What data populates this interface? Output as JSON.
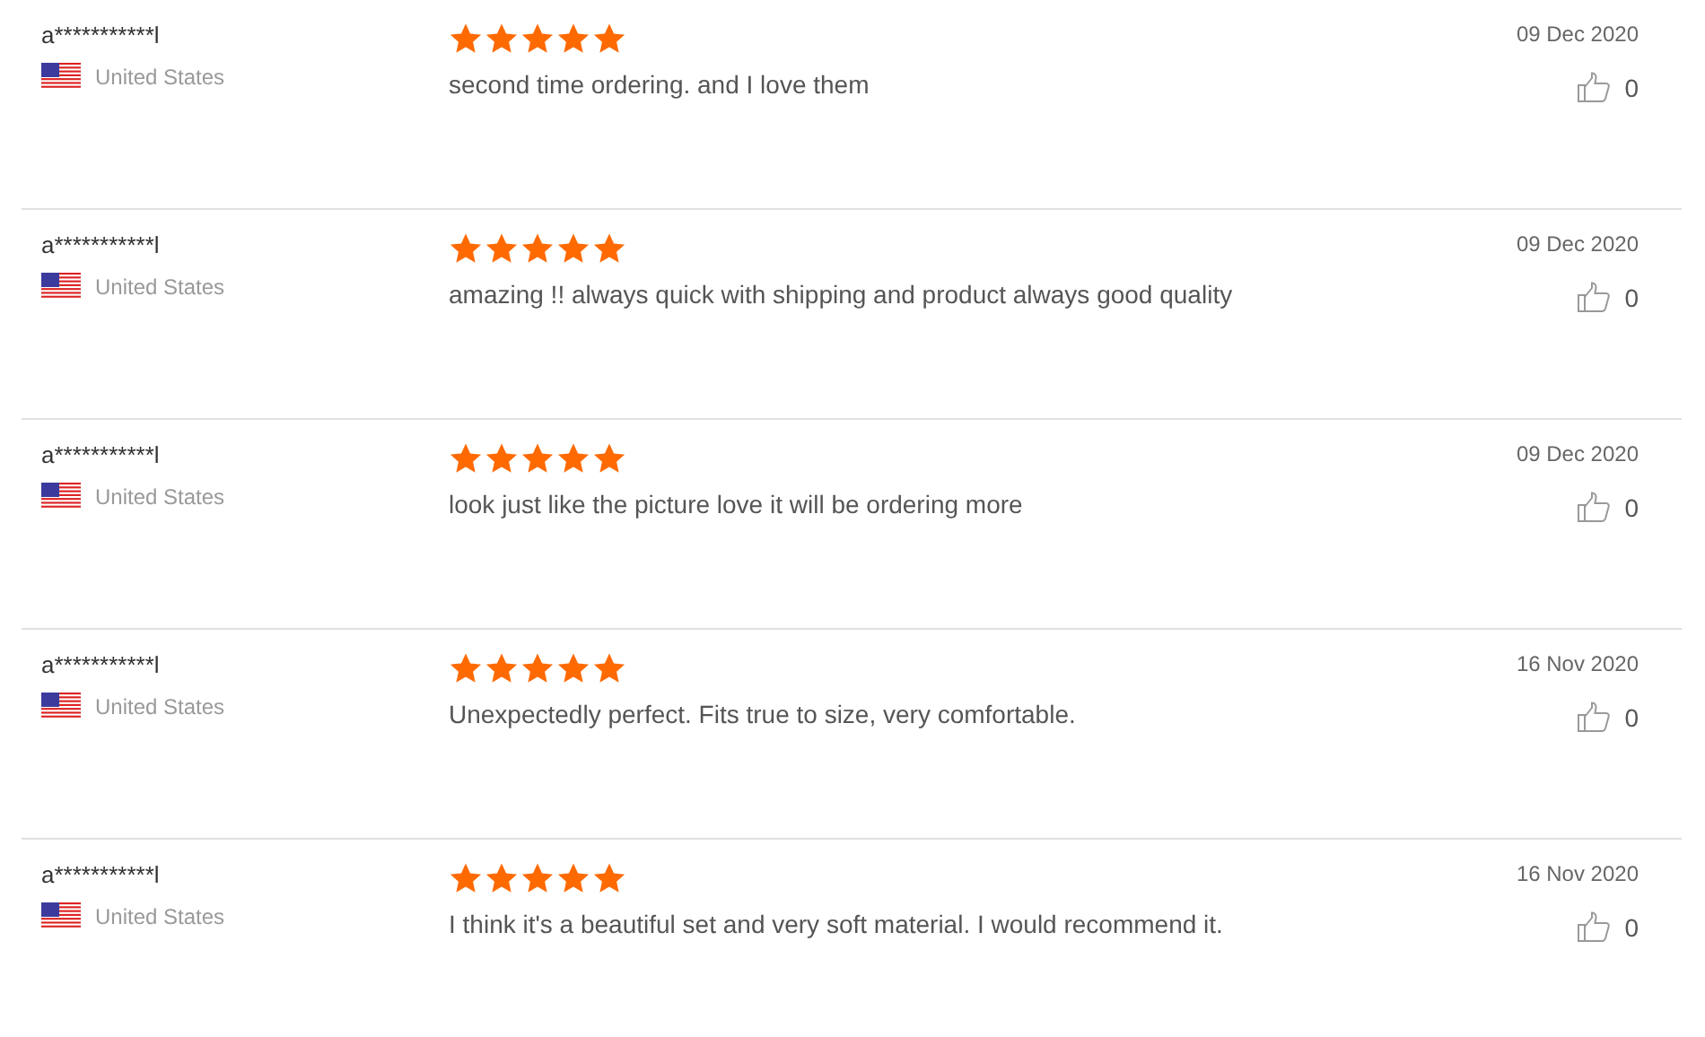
{
  "reviews": [
    {
      "name": "a***********l",
      "country": "United States",
      "stars": 5,
      "text": "second time ordering. and I love them",
      "date": "09 Dec 2020",
      "likes": "0"
    },
    {
      "name": "a***********l",
      "country": "United States",
      "stars": 5,
      "text": "amazing !! always quick with shipping and product always good quality",
      "date": "09 Dec 2020",
      "likes": "0"
    },
    {
      "name": "a***********l",
      "country": "United States",
      "stars": 5,
      "text": "look just like the picture love it will be ordering more",
      "date": "09 Dec 2020",
      "likes": "0"
    },
    {
      "name": "a***********l",
      "country": "United States",
      "stars": 5,
      "text": "Unexpectedly perfect. Fits true to size, very comfortable.",
      "date": "16 Nov 2020",
      "likes": "0"
    },
    {
      "name": "a***********l",
      "country": "United States",
      "stars": 5,
      "text": "I think it's a beautiful set and very soft material. I would recommend it.",
      "date": "16 Nov 2020",
      "likes": "0"
    }
  ]
}
